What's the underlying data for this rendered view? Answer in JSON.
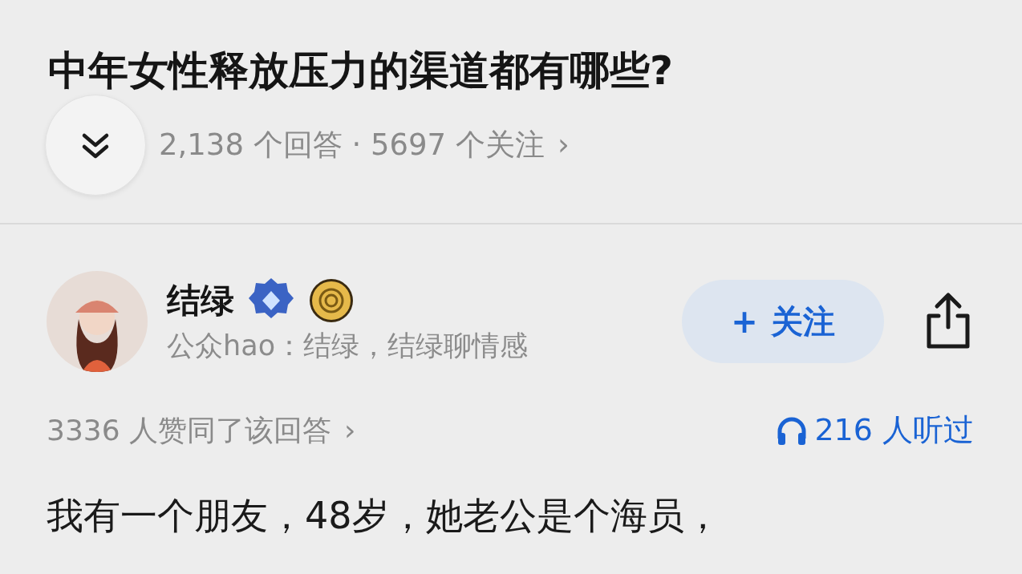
{
  "question": {
    "title": "中年女性释放压力的渠道都有哪些?",
    "stats": "2,138 个回答 · 5697 个关注",
    "stats_chevron": "›"
  },
  "answer": {
    "author": {
      "name": "结绿",
      "subtitle": "公众hao：结绿，结绿聊情感"
    },
    "follow_button": {
      "plus": "+",
      "label": "关注"
    },
    "likes": "3336 人赞同了该回答",
    "likes_chevron": "›",
    "listens": "216 人听过",
    "body": "我有一个朋友，48岁，她老公是个海员，"
  }
}
